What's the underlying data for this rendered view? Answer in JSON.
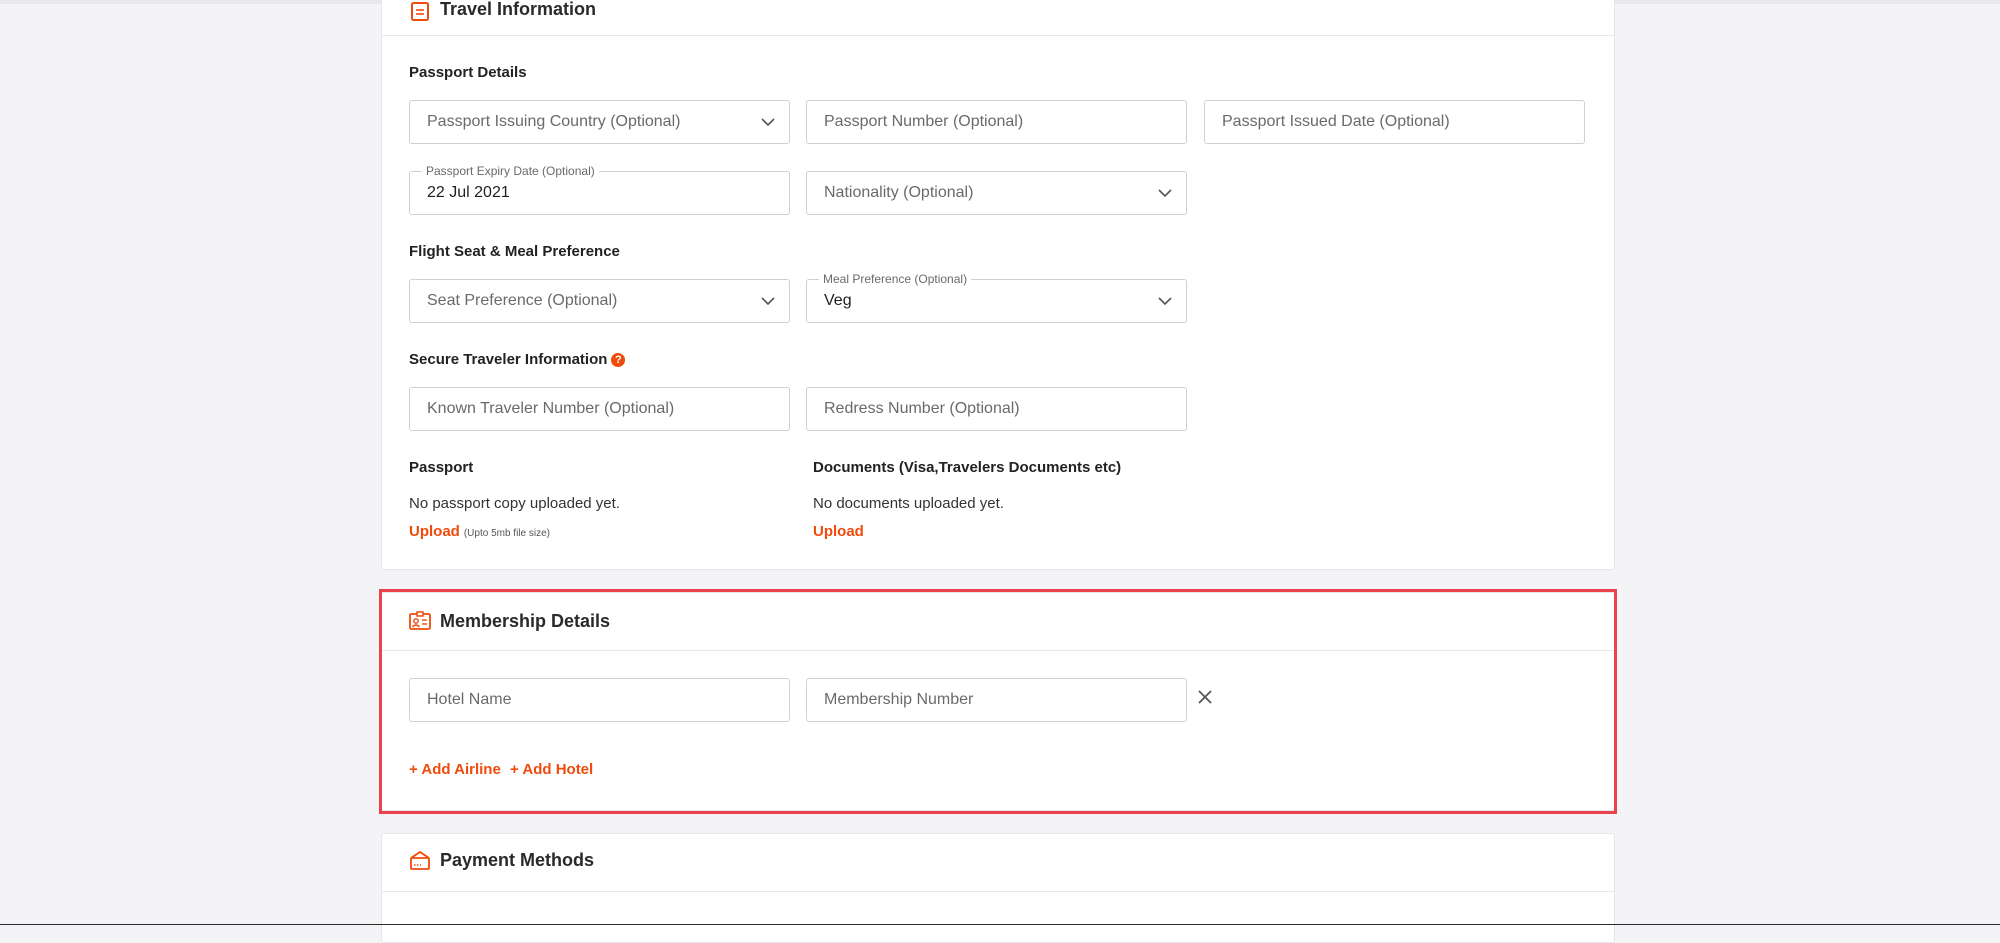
{
  "travel": {
    "title": "Travel Information",
    "passport_details_label": "Passport Details",
    "issuing_country_ph": "Passport Issuing Country (Optional)",
    "passport_number_ph": "Passport Number (Optional)",
    "issued_date_ph": "Passport Issued Date (Optional)",
    "expiry_label": "Passport Expiry Date (Optional)",
    "expiry_value": "22 Jul 2021",
    "nationality_ph": "Nationality (Optional)",
    "seat_meal_label": "Flight Seat & Meal Preference",
    "seat_ph": "Seat Preference (Optional)",
    "meal_label": "Meal Preference (Optional)",
    "meal_value": "Veg",
    "secure_label": "Secure Traveler Information",
    "ktn_ph": "Known Traveler Number (Optional)",
    "redress_ph": "Redress Number (Optional)",
    "passport_label": "Passport",
    "passport_status": "No passport copy uploaded yet.",
    "passport_upload": "Upload",
    "passport_upload_hint": "(Upto 5mb file size)",
    "documents_label": "Documents (Visa,Travelers Documents etc)",
    "documents_status": "No documents uploaded yet.",
    "documents_upload": "Upload"
  },
  "membership": {
    "title": "Membership Details",
    "hotel_name_ph": "Hotel Name",
    "membership_number_ph": "Membership Number",
    "add_airline": "+ Add Airline",
    "add_hotel": "+ Add Hotel"
  },
  "payment": {
    "title": "Payment Methods"
  },
  "colors": {
    "accent": "#ef4b0c",
    "highlight": "#e8434f"
  },
  "icons": {
    "travel": "document-icon",
    "membership": "id-card-icon",
    "payment": "card-icon",
    "dropdown": "chevron-down-icon",
    "remove": "close-icon",
    "help": "question-circle-icon"
  }
}
